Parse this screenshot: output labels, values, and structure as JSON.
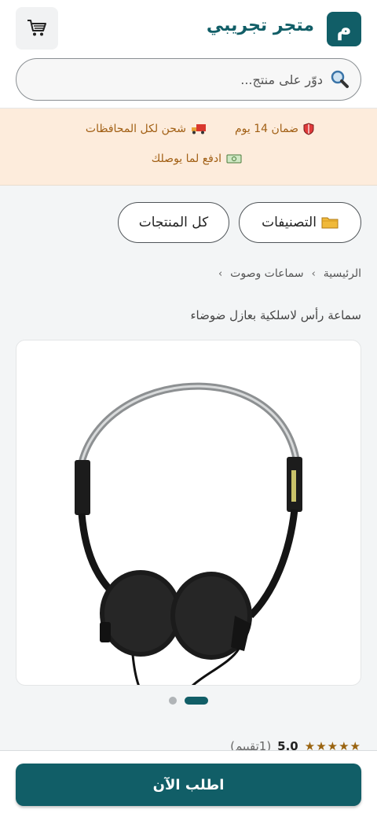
{
  "header": {
    "logo_letter": "م",
    "store_name": "متجر تجريبي"
  },
  "search": {
    "placeholder": "دوّر على منتج..."
  },
  "banner": {
    "features": [
      {
        "icon": "shield-icon",
        "label": "ضمان 14 يوم"
      },
      {
        "icon": "truck-icon",
        "label": "شحن لكل المحافظات"
      },
      {
        "icon": "cash-icon",
        "label": "ادفع لما يوصلك"
      }
    ]
  },
  "nav": {
    "categories_label": "التصنيفات",
    "all_products_label": "كل المنتجات"
  },
  "breadcrumb": {
    "home": "الرئيسية",
    "category": "سماعات وصوت",
    "separator": "›"
  },
  "product": {
    "title": "سماعة رأس لاسلكية بعازل ضوضاء",
    "rating": "5.0",
    "stars": "★★★★★",
    "rating_count": "(1تقييم)",
    "image_count": 2,
    "active_image": 1
  },
  "cta": {
    "order_label": "اطلب الآن"
  },
  "colors": {
    "brand": "#115e67",
    "banner_bg": "#fdecdc",
    "banner_text": "#a15f14",
    "star": "#9a6410"
  }
}
